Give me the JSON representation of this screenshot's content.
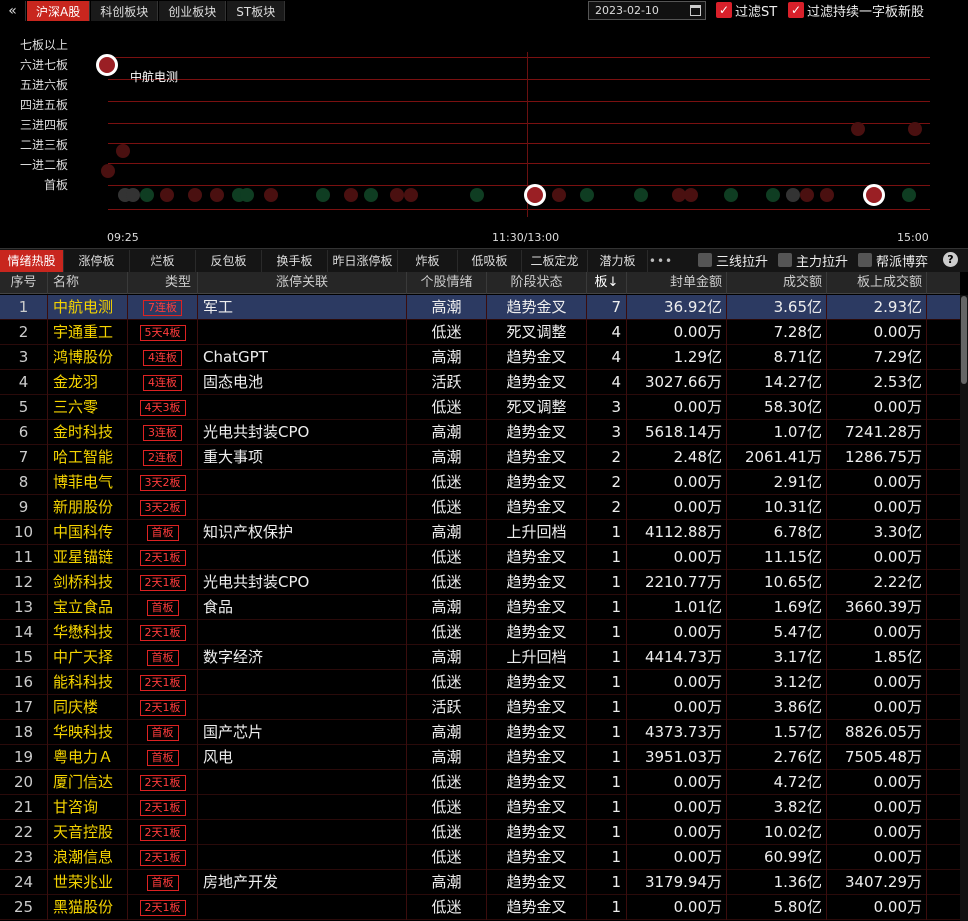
{
  "topbar": {
    "back_icon": "double-chevron-left-icon",
    "market_tabs": [
      {
        "label": "沪深A股",
        "active": true
      },
      {
        "label": "科创板块",
        "active": false
      },
      {
        "label": "创业板块",
        "active": false
      },
      {
        "label": "ST板块",
        "active": false
      }
    ],
    "date": "2023-02-10",
    "calendar_icon": "calendar-icon",
    "filter_st": {
      "label": "过滤ST",
      "checked": true
    },
    "filter_new": {
      "label": "过滤持续一字板新股",
      "checked": true
    }
  },
  "ladder_chart": {
    "levels": [
      "七板以上",
      "六进七板",
      "五进六板",
      "四进五板",
      "三进四板",
      "二进三板",
      "一进二板",
      "首板"
    ],
    "highlight_label": "中航电测",
    "x_ticks": [
      "09:25",
      "11:30/13:00",
      "15:00"
    ],
    "colors": {
      "grid": "#7a1010",
      "highlight": "#9a1f24",
      "up": "#0f3d22",
      "down": "#4a1010"
    }
  },
  "sub_tabs": [
    {
      "label": "情绪热股",
      "active": true
    },
    {
      "label": "涨停板",
      "active": false
    },
    {
      "label": "烂板",
      "active": false
    },
    {
      "label": "反包板",
      "active": false
    },
    {
      "label": "换手板",
      "active": false
    },
    {
      "label": "昨日涨停板",
      "active": false
    },
    {
      "label": "炸板",
      "active": false
    },
    {
      "label": "低吸板",
      "active": false
    },
    {
      "label": "二板定龙",
      "active": false
    },
    {
      "label": "潜力板",
      "active": false
    }
  ],
  "more_label": "•••",
  "filters": [
    {
      "label": "三线拉升",
      "checked": false
    },
    {
      "label": "主力拉升",
      "checked": false
    },
    {
      "label": "帮派博弈",
      "checked": false
    }
  ],
  "help_label": "?",
  "table": {
    "headers": [
      "序号",
      "名称",
      "类型",
      "涨停关联",
      "个股情绪",
      "阶段状态",
      "板↓",
      "封单金额",
      "成交额",
      "板上成交额"
    ],
    "rows": [
      {
        "idx": "1",
        "name": "中航电测",
        "type": "7连板",
        "rel": "军工",
        "mood": "高潮",
        "stage": "趋势金叉",
        "ban": "7",
        "feng": "36.92亿",
        "cj": "3.65亿",
        "bscj": "2.93亿",
        "selected": true
      },
      {
        "idx": "2",
        "name": "宇通重工",
        "type": "5天4板",
        "rel": "",
        "mood": "低迷",
        "stage": "死叉调整",
        "ban": "4",
        "feng": "0.00万",
        "cj": "7.28亿",
        "bscj": "0.00万"
      },
      {
        "idx": "3",
        "name": "鸿博股份",
        "type": "4连板",
        "rel": "ChatGPT",
        "mood": "高潮",
        "stage": "趋势金叉",
        "ban": "4",
        "feng": "1.29亿",
        "cj": "8.71亿",
        "bscj": "7.29亿"
      },
      {
        "idx": "4",
        "name": "金龙羽",
        "type": "4连板",
        "rel": "固态电池",
        "mood": "活跃",
        "stage": "趋势金叉",
        "ban": "4",
        "feng": "3027.66万",
        "cj": "14.27亿",
        "bscj": "2.53亿"
      },
      {
        "idx": "5",
        "name": "三六零",
        "type": "4天3板",
        "rel": "",
        "mood": "低迷",
        "stage": "死叉调整",
        "ban": "3",
        "feng": "0.00万",
        "cj": "58.30亿",
        "bscj": "0.00万"
      },
      {
        "idx": "6",
        "name": "金时科技",
        "type": "3连板",
        "rel": "光电共封装CPO",
        "mood": "高潮",
        "stage": "趋势金叉",
        "ban": "3",
        "feng": "5618.14万",
        "cj": "1.07亿",
        "bscj": "7241.28万"
      },
      {
        "idx": "7",
        "name": "哈工智能",
        "type": "2连板",
        "rel": "重大事项",
        "mood": "高潮",
        "stage": "趋势金叉",
        "ban": "2",
        "feng": "2.48亿",
        "cj": "2061.41万",
        "bscj": "1286.75万"
      },
      {
        "idx": "8",
        "name": "博菲电气",
        "type": "3天2板",
        "rel": "",
        "mood": "低迷",
        "stage": "趋势金叉",
        "ban": "2",
        "feng": "0.00万",
        "cj": "2.91亿",
        "bscj": "0.00万"
      },
      {
        "idx": "9",
        "name": "新朋股份",
        "type": "3天2板",
        "rel": "",
        "mood": "低迷",
        "stage": "趋势金叉",
        "ban": "2",
        "feng": "0.00万",
        "cj": "10.31亿",
        "bscj": "0.00万"
      },
      {
        "idx": "10",
        "name": "中国科传",
        "type": "首板",
        "rel": "知识产权保护",
        "mood": "高潮",
        "stage": "上升回档",
        "ban": "1",
        "feng": "4112.88万",
        "cj": "6.78亿",
        "bscj": "3.30亿"
      },
      {
        "idx": "11",
        "name": "亚星锚链",
        "type": "2天1板",
        "rel": "",
        "mood": "低迷",
        "stage": "趋势金叉",
        "ban": "1",
        "feng": "0.00万",
        "cj": "11.15亿",
        "bscj": "0.00万"
      },
      {
        "idx": "12",
        "name": "剑桥科技",
        "type": "2天1板",
        "rel": "光电共封装CPO",
        "mood": "低迷",
        "stage": "趋势金叉",
        "ban": "1",
        "feng": "2210.77万",
        "cj": "10.65亿",
        "bscj": "2.22亿"
      },
      {
        "idx": "13",
        "name": "宝立食品",
        "type": "首板",
        "rel": "食品",
        "mood": "高潮",
        "stage": "趋势金叉",
        "ban": "1",
        "feng": "1.01亿",
        "cj": "1.69亿",
        "bscj": "3660.39万"
      },
      {
        "idx": "14",
        "name": "华懋科技",
        "type": "2天1板",
        "rel": "",
        "mood": "低迷",
        "stage": "趋势金叉",
        "ban": "1",
        "feng": "0.00万",
        "cj": "5.47亿",
        "bscj": "0.00万"
      },
      {
        "idx": "15",
        "name": "中广天择",
        "type": "首板",
        "rel": "数字经济",
        "mood": "高潮",
        "stage": "上升回档",
        "ban": "1",
        "feng": "4414.73万",
        "cj": "3.17亿",
        "bscj": "1.85亿"
      },
      {
        "idx": "16",
        "name": "能科科技",
        "type": "2天1板",
        "rel": "",
        "mood": "低迷",
        "stage": "趋势金叉",
        "ban": "1",
        "feng": "0.00万",
        "cj": "3.12亿",
        "bscj": "0.00万"
      },
      {
        "idx": "17",
        "name": "同庆楼",
        "type": "2天1板",
        "rel": "",
        "mood": "活跃",
        "stage": "趋势金叉",
        "ban": "1",
        "feng": "0.00万",
        "cj": "3.86亿",
        "bscj": "0.00万"
      },
      {
        "idx": "18",
        "name": "华映科技",
        "type": "首板",
        "rel": "国产芯片",
        "mood": "高潮",
        "stage": "趋势金叉",
        "ban": "1",
        "feng": "4373.73万",
        "cj": "1.57亿",
        "bscj": "8826.05万"
      },
      {
        "idx": "19",
        "name": "粤电力Ａ",
        "type": "首板",
        "rel": "风电",
        "mood": "高潮",
        "stage": "趋势金叉",
        "ban": "1",
        "feng": "3951.03万",
        "cj": "2.76亿",
        "bscj": "7505.48万"
      },
      {
        "idx": "20",
        "name": "厦门信达",
        "type": "2天1板",
        "rel": "",
        "mood": "低迷",
        "stage": "趋势金叉",
        "ban": "1",
        "feng": "0.00万",
        "cj": "4.72亿",
        "bscj": "0.00万"
      },
      {
        "idx": "21",
        "name": "甘咨询",
        "type": "2天1板",
        "rel": "",
        "mood": "低迷",
        "stage": "趋势金叉",
        "ban": "1",
        "feng": "0.00万",
        "cj": "3.82亿",
        "bscj": "0.00万"
      },
      {
        "idx": "22",
        "name": "天音控股",
        "type": "2天1板",
        "rel": "",
        "mood": "低迷",
        "stage": "趋势金叉",
        "ban": "1",
        "feng": "0.00万",
        "cj": "10.02亿",
        "bscj": "0.00万"
      },
      {
        "idx": "23",
        "name": "浪潮信息",
        "type": "2天1板",
        "rel": "",
        "mood": "低迷",
        "stage": "趋势金叉",
        "ban": "1",
        "feng": "0.00万",
        "cj": "60.99亿",
        "bscj": "0.00万"
      },
      {
        "idx": "24",
        "name": "世荣兆业",
        "type": "首板",
        "rel": "房地产开发",
        "mood": "高潮",
        "stage": "趋势金叉",
        "ban": "1",
        "feng": "3179.94万",
        "cj": "1.36亿",
        "bscj": "3407.29万"
      },
      {
        "idx": "25",
        "name": "黑猫股份",
        "type": "2天1板",
        "rel": "",
        "mood": "低迷",
        "stage": "趋势金叉",
        "ban": "1",
        "feng": "0.00万",
        "cj": "5.80亿",
        "bscj": "0.00万"
      }
    ]
  }
}
